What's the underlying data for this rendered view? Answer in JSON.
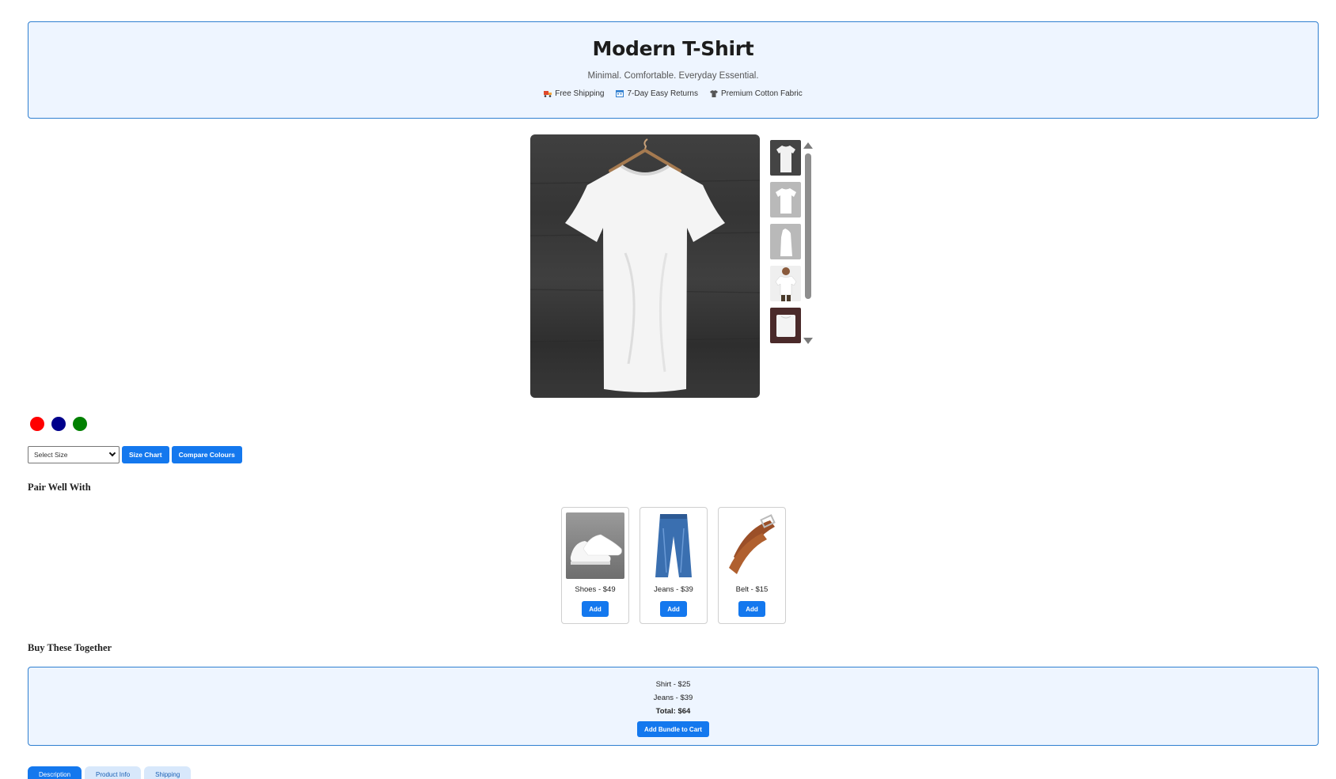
{
  "hero": {
    "title": "Modern T-Shirt",
    "tagline": "Minimal. Comfortable. Everyday Essential.",
    "features": [
      {
        "icon": "truck-icon",
        "label": "Free Shipping"
      },
      {
        "icon": "calendar-icon",
        "label": "7-Day Easy Returns"
      },
      {
        "icon": "shirt-icon",
        "label": "Premium Cotton Fabric"
      }
    ]
  },
  "gallery": {
    "main_image": "white-tshirt-on-hanger",
    "thumbnails": [
      "tshirt-hanger",
      "tshirt-front",
      "tshirt-side",
      "tshirt-model",
      "tshirt-folded"
    ]
  },
  "colors": [
    "#ff0000",
    "#00008b",
    "#008000"
  ],
  "size_select": {
    "selected": "Select Size"
  },
  "buttons": {
    "size_chart": "Size Chart",
    "compare_colours": "Compare Colours"
  },
  "pair_section": {
    "title": "Pair Well With",
    "items": [
      {
        "label": "Shoes - $49",
        "button": "Add"
      },
      {
        "label": "Jeans - $39",
        "button": "Add"
      },
      {
        "label": "Belt - $15",
        "button": "Add"
      }
    ]
  },
  "bundle_section": {
    "title": "Buy These Together",
    "lines": [
      "Shirt - $25",
      "Jeans - $39"
    ],
    "total": "Total: $64",
    "button": "Add Bundle to Cart"
  },
  "tabs": [
    "Description",
    "Product Info",
    "Shipping"
  ],
  "accent": "#1478ee"
}
